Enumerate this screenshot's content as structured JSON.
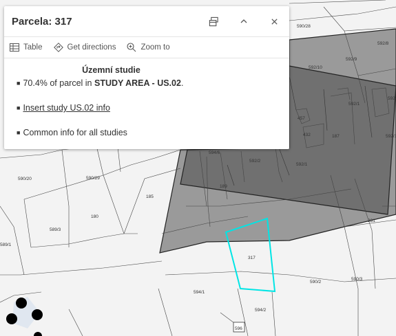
{
  "popup": {
    "title": "Parcela: 317",
    "dock_icon": "dock-icon",
    "collapse_icon": "chevron-up-icon",
    "close_icon": "close-icon",
    "actions": [
      {
        "label": "Table",
        "icon": "table-icon"
      },
      {
        "label": "Get directions",
        "icon": "directions-icon"
      },
      {
        "label": "Zoom to",
        "icon": "zoom-to-icon"
      }
    ],
    "heading": "Územní studie",
    "line1_pre": "70.4% of parcel in ",
    "line1_bold": "STUDY AREA - US.02",
    "line1_post": ".",
    "link": "Insert study US.02 info",
    "line3": "Common info for all studies"
  },
  "map": {
    "highlight_color": "#00e5e5",
    "study_area_color": "#8c8c8c",
    "dark_area_color": "#6e6e6e",
    "parcel_labels": [
      "590/28",
      "592/8",
      "592/10",
      "592/9",
      "592/12",
      "592/1",
      "592/11",
      "592/7",
      "594/5",
      "592/2",
      "590/20",
      "590/29",
      "185",
      "180",
      "589/3",
      "589/1",
      "231",
      "317",
      "590/2",
      "594/1",
      "594/2",
      "596",
      "457",
      "432"
    ]
  }
}
